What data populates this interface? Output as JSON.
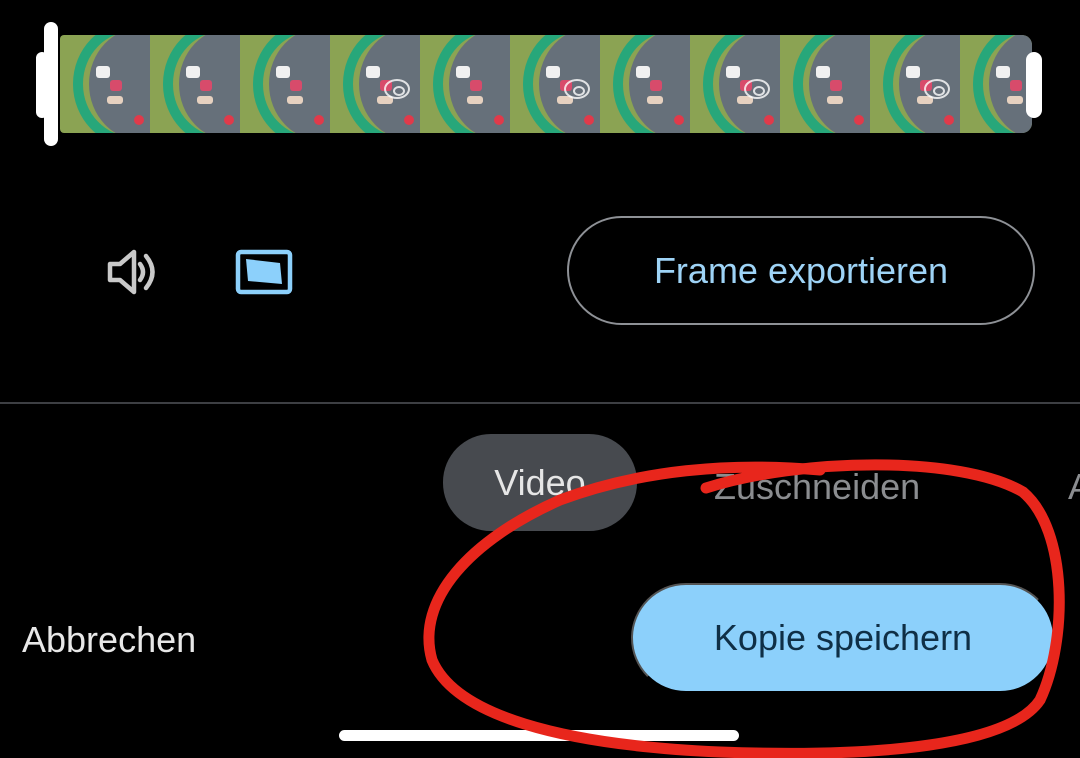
{
  "editor": {
    "timeline": {
      "thumbnail_count": 11,
      "thumbnail_style": "trampoline-kids-overhead"
    },
    "controls": {
      "volume_icon": "volume-icon",
      "aspect_icon": "aspect-ratio-icon",
      "frame_export_label": "Frame exportieren"
    },
    "tabs": [
      {
        "label": "Video",
        "selected": true
      },
      {
        "label": "Zuschneiden",
        "selected": false
      },
      {
        "label": "A",
        "selected": false
      }
    ],
    "actions": {
      "cancel_label": "Abbrechen",
      "save_copy_label": "Kopie speichern"
    },
    "colors": {
      "accent": "#8cd0fb",
      "accent_text": "#9ed3f6",
      "annotation_red": "#e8261c",
      "background": "#000000"
    }
  }
}
